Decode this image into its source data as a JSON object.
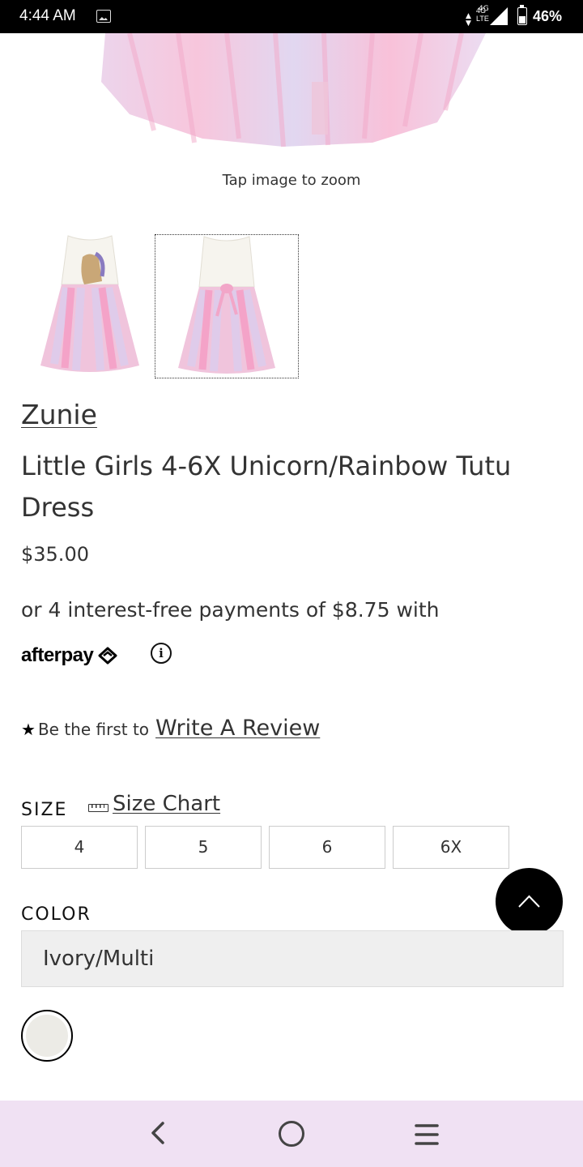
{
  "status_bar": {
    "time": "4:44 AM",
    "network": [
      "4G",
      "LTE"
    ],
    "battery": "46%",
    "battery_level": 0.46
  },
  "gallery": {
    "zoom_hint": "Tap image to zoom",
    "thumbnails_count": 2,
    "selected_thumbnail_index": 1
  },
  "product": {
    "brand": "Zunie",
    "title": "Little Girls 4-6X Unicorn/Rainbow Tutu Dress",
    "price": "$35.00",
    "installments": "or 4 interest-free payments of $8.75 with",
    "afterpay_logo": "afterpay",
    "info_icon": "i"
  },
  "reviews": {
    "star": "★",
    "prefix": "Be the first to",
    "link": "Write A Review"
  },
  "size": {
    "label": "SIZE",
    "chart_link": "Size Chart",
    "options": [
      "4",
      "5",
      "6",
      "6X"
    ]
  },
  "color": {
    "label": "COLOR",
    "selected": "Ivory/Multi",
    "swatch_color": "#ecebe6"
  },
  "colors": {
    "nav_bar_bg": "#f0e1f3",
    "tutu_pink": "#f7b6d2",
    "tutu_lilac": "#d9c9ec"
  }
}
